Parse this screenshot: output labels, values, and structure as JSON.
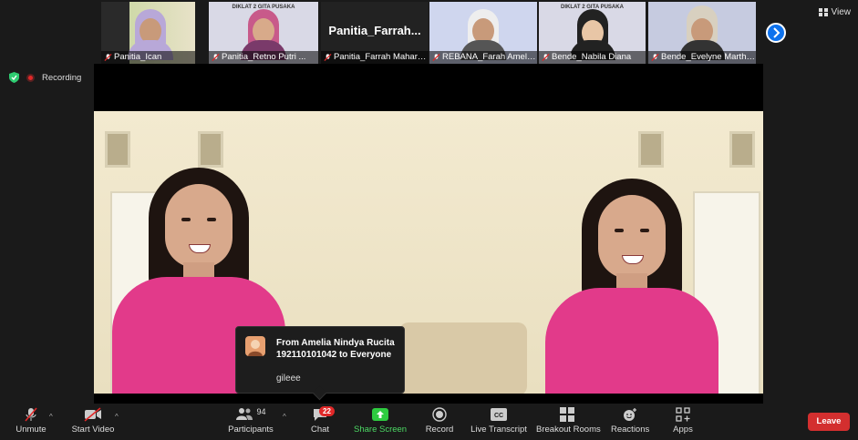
{
  "thumbnails": [
    {
      "label": "Panitia_Ican",
      "banner": ""
    },
    {
      "label": "Panitia_Retno Putri ...",
      "banner": "DIKLAT 2 GITA PUSAKA"
    },
    {
      "label": "Panitia_Farrah Mahara...",
      "big_name": "Panitia_Farrah..."
    },
    {
      "label": "REBANA_Farah Amelia Da...",
      "banner": ""
    },
    {
      "label": "Bende_Nabila Diana",
      "banner": "DIKLAT 2 GITA PUSAKA"
    },
    {
      "label": "Bende_Evelyne Martha...",
      "banner": ""
    }
  ],
  "view_label": "View",
  "recording_label": "Recording",
  "chat_popup": {
    "from": "From Amelia Nindya Rucita 192110101042 to Everyone",
    "message": "gileee"
  },
  "toolbar": {
    "unmute": "Unmute",
    "start_video": "Start Video",
    "participants": "Participants",
    "participants_count": "94",
    "chat": "Chat",
    "chat_badge": "22",
    "share_screen": "Share Screen",
    "record": "Record",
    "live_transcript": "Live Transcript",
    "breakout_rooms": "Breakout Rooms",
    "reactions": "Reactions",
    "apps": "Apps",
    "leave": "Leave"
  },
  "colors": {
    "accent": "#0e72ed",
    "share": "#4cd964",
    "leave": "#d32f2f",
    "shirt": "#e23a8a"
  }
}
